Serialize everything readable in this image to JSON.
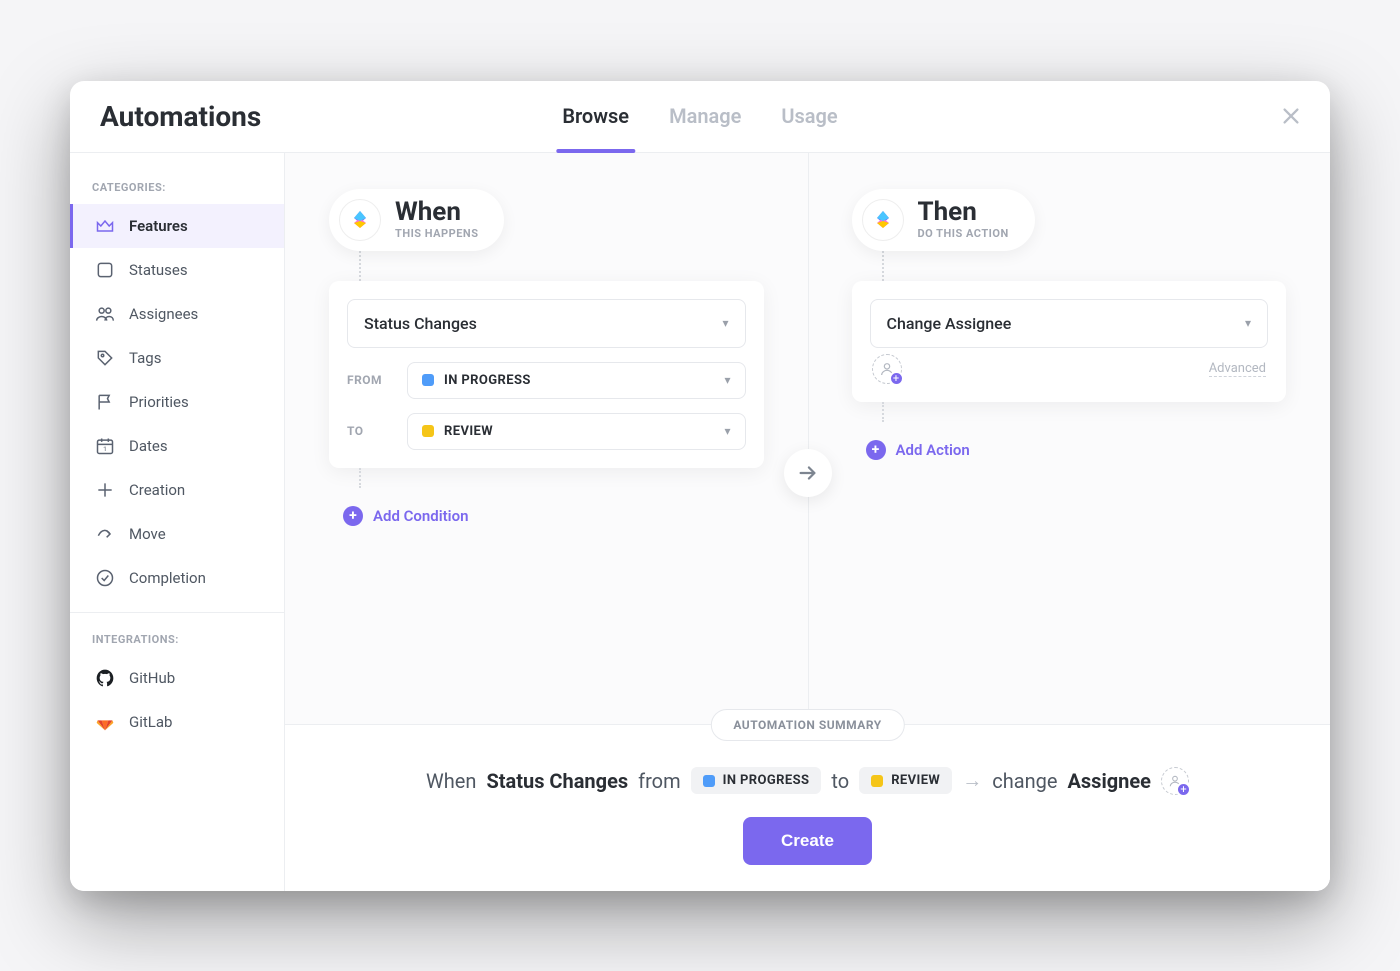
{
  "header": {
    "title": "Automations",
    "tabs": [
      "Browse",
      "Manage",
      "Usage"
    ],
    "active_tab": "Browse"
  },
  "sidebar": {
    "categories_heading": "CATEGORIES:",
    "categories": [
      {
        "label": "Features",
        "icon": "crown-icon",
        "active": true
      },
      {
        "label": "Statuses",
        "icon": "square-icon"
      },
      {
        "label": "Assignees",
        "icon": "users-icon"
      },
      {
        "label": "Tags",
        "icon": "tag-icon"
      },
      {
        "label": "Priorities",
        "icon": "flag-icon"
      },
      {
        "label": "Dates",
        "icon": "calendar-icon"
      },
      {
        "label": "Creation",
        "icon": "plus-icon"
      },
      {
        "label": "Move",
        "icon": "share-icon"
      },
      {
        "label": "Completion",
        "icon": "check-circle-icon"
      }
    ],
    "integrations_heading": "INTEGRATIONS:",
    "integrations": [
      {
        "label": "GitHub",
        "icon": "github-icon"
      },
      {
        "label": "GitLab",
        "icon": "gitlab-icon"
      }
    ]
  },
  "when": {
    "title": "When",
    "subtitle": "THIS HAPPENS",
    "trigger": "Status Changes",
    "from_label": "FROM",
    "from_status": "IN PROGRESS",
    "from_color": "#4f9cf9",
    "to_label": "TO",
    "to_status": "REVIEW",
    "to_color": "#f5c518",
    "add_condition": "Add Condition"
  },
  "then": {
    "title": "Then",
    "subtitle": "DO THIS ACTION",
    "action": "Change Assignee",
    "advanced": "Advanced",
    "add_action": "Add Action"
  },
  "summary": {
    "badge": "AUTOMATION SUMMARY",
    "when_word": "When",
    "trigger": "Status Changes",
    "from_word": "from",
    "from_status": "IN PROGRESS",
    "to_word": "to",
    "to_status": "REVIEW",
    "change_word": "change",
    "target": "Assignee",
    "create": "Create"
  }
}
